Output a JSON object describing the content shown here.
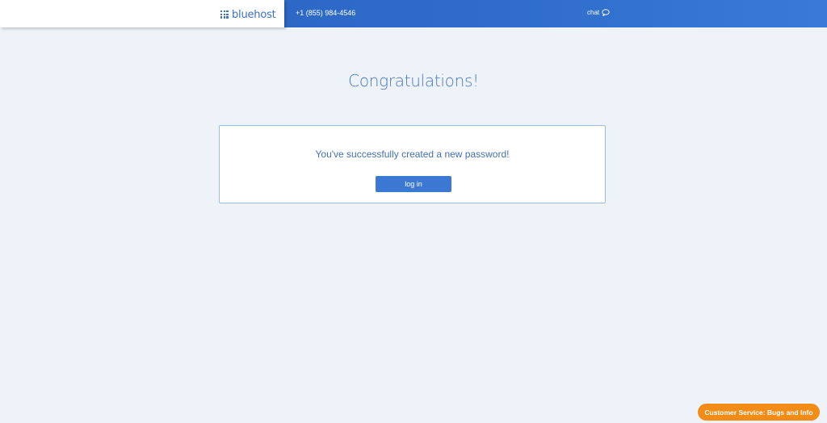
{
  "header": {
    "logo_text": "bluehost",
    "logo_icon": "grid-icon",
    "phone": "+1 (855) 984-4546",
    "chat_label": "chat",
    "chat_icon": "chat-bubble-icon"
  },
  "main": {
    "title": "Congratulations!",
    "message": "You've successfully created a new password!",
    "login_label": "log in"
  },
  "support": {
    "label": "Customer Service: Bugs and Info"
  },
  "colors": {
    "brand_blue": "#2f6ccb",
    "accent_orange": "#f28c16",
    "page_background": "#edf3f9"
  }
}
